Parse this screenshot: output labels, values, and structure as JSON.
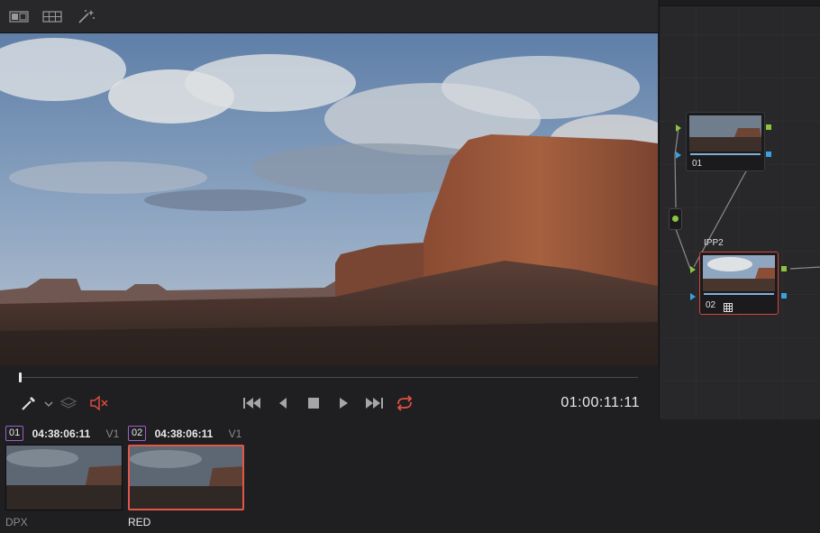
{
  "toolbar": {
    "icons": [
      "split-view-icon",
      "grid-view-icon",
      "magic-wand-icon"
    ]
  },
  "transport": {
    "timecode": "01:00:11:11",
    "playhead_fraction": 0.0,
    "icons": [
      "eyedropper-icon",
      "chevron-down-icon",
      "layers-icon",
      "mute-icon",
      "go-to-start-icon",
      "step-back-icon",
      "stop-icon",
      "play-icon",
      "go-to-end-icon",
      "loop-icon"
    ],
    "colors": {
      "mute": "#d94b3f",
      "loop": "#e05243"
    }
  },
  "node_editor": {
    "nodes": [
      {
        "label": "01",
        "selected": false
      },
      {
        "label": "02",
        "selected": true,
        "title": "IPP2"
      }
    ],
    "selected_color": "#d2463c",
    "rgb_port_color": "#8cc43f",
    "alpha_port_color": "#3aa0e0"
  },
  "clips": [
    {
      "number": "01",
      "timecode": "04:38:06:11",
      "track": "V1",
      "codec": "DPX",
      "selected": false
    },
    {
      "number": "02",
      "timecode": "04:38:06:11",
      "track": "V1",
      "codec": "RED",
      "selected": true
    }
  ]
}
